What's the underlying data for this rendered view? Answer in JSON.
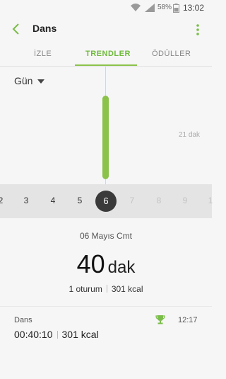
{
  "status_bar": {
    "battery_percent": "58%",
    "clock": "13:02",
    "icons": [
      "wifi-icon",
      "signal-icon",
      "battery-icon"
    ]
  },
  "app_bar": {
    "title": "Dans",
    "back_icon": "chevron-left-icon",
    "menu_icon": "more-vert-icon"
  },
  "tabs": [
    {
      "label": "İZLE",
      "active": false
    },
    {
      "label": "TRENDLER",
      "active": true
    },
    {
      "label": "ÖDÜLLER",
      "active": false
    }
  ],
  "period_selector": {
    "value": "Gün",
    "icon": "caret-down-icon"
  },
  "chart": {
    "reference_label": "21 dak",
    "bar_value_minutes": 40,
    "reference_minutes": 21
  },
  "day_strip": {
    "days": [
      "2",
      "3",
      "4",
      "5",
      "6",
      "7",
      "8",
      "9",
      "1"
    ],
    "selected": "6"
  },
  "detail": {
    "date": "06 Mayıs Cmt",
    "value": "40",
    "unit": "dak",
    "sessions": "1 oturum",
    "calories": "301 kcal"
  },
  "entry": {
    "name": "Dans",
    "time": "12:17",
    "duration": "00:40:10",
    "calories": "301 kcal",
    "icon": "trophy-icon"
  },
  "colors": {
    "accent": "#8bc34a",
    "guideline": "#f1d39e",
    "selected_day": "#3a3a3a"
  }
}
